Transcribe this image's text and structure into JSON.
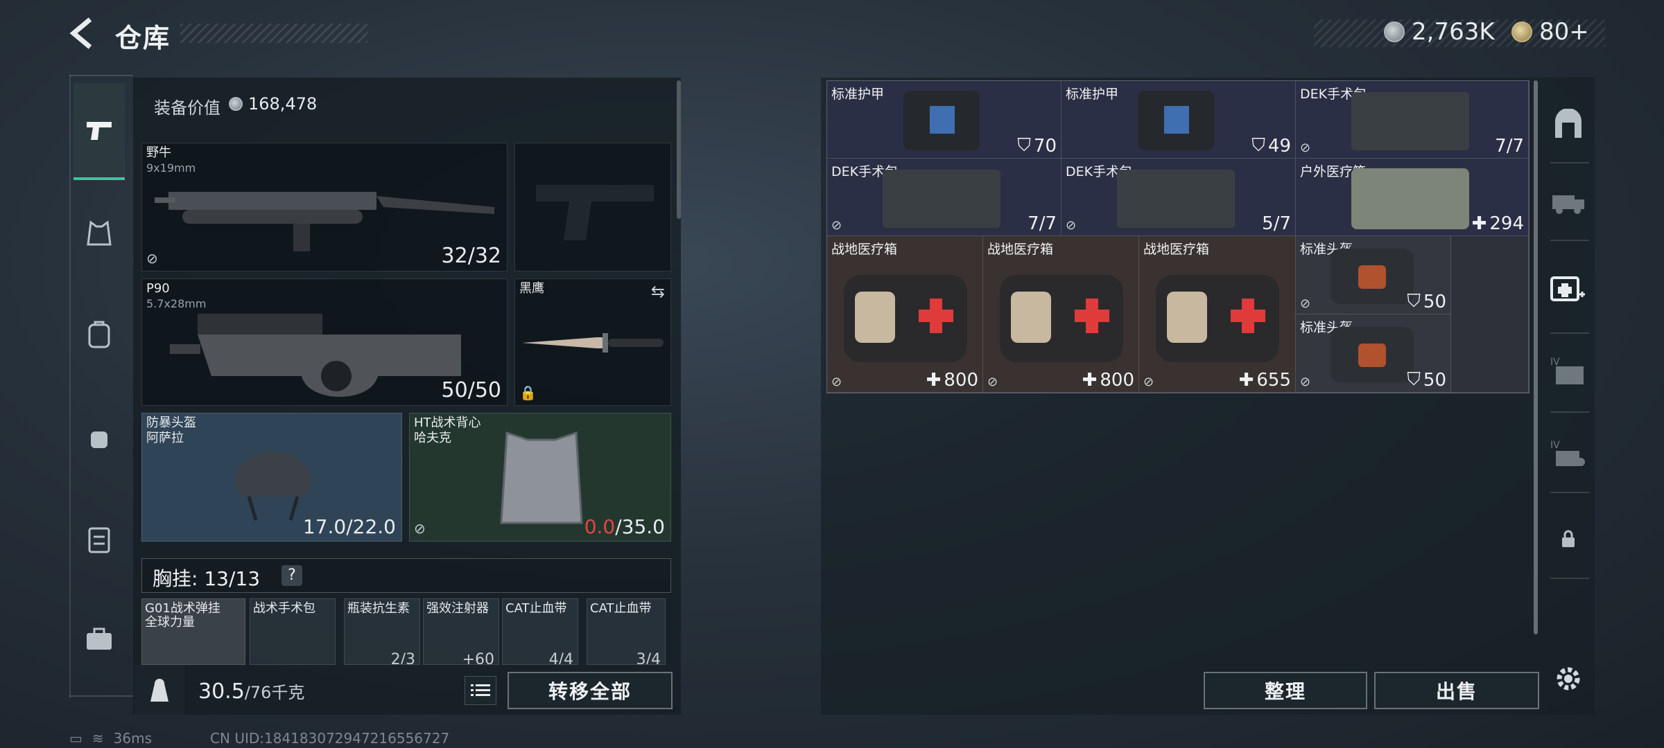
{
  "header": {
    "title": "仓库"
  },
  "currency": {
    "silver": "2,763K",
    "gold": "80+"
  },
  "equipment": {
    "value_label": "装备价值",
    "value": "168,478",
    "primary": {
      "name": "野牛",
      "caliber": "9x19mm",
      "count": "32/32"
    },
    "secondary": {
      "name": "P90",
      "caliber": "5.7x28mm",
      "count": "50/50"
    },
    "melee": {
      "name": "黑鹰"
    },
    "helmet": {
      "name": "防暴头盔",
      "brand": "阿萨拉",
      "durability": "17.0/22.0"
    },
    "vest": {
      "name": "HT战术背心",
      "brand": "哈夫克",
      "durability_current": "0.0",
      "durability_max": "/35.0"
    }
  },
  "chest_rig": {
    "label": "胸挂: 13/13",
    "help": "?",
    "items": [
      {
        "name": "G01战术弹挂\n全球力量"
      },
      {
        "name": "战术手术包"
      },
      {
        "name": "瓶装抗生素",
        "count": "2/3"
      },
      {
        "name": "强效注射器",
        "count": "+60"
      },
      {
        "name": "CAT止血带",
        "count": "4/4"
      },
      {
        "name": "CAT止血带",
        "count": "3/4"
      }
    ]
  },
  "footer": {
    "weight_current": "30.5",
    "weight_max": "/76千克",
    "transfer_all": "转移全部",
    "organize": "整理",
    "sell": "出售"
  },
  "storage": [
    {
      "name": "标准护甲",
      "count": "70",
      "count_icon": "shield-icon"
    },
    {
      "name": "标准护甲",
      "count": "49",
      "count_icon": "shield-icon"
    },
    {
      "name": "DEK手术包",
      "count": "7/7"
    },
    {
      "name": "DEK手术包",
      "count": "7/7"
    },
    {
      "name": "DEK手术包",
      "count": "5/7"
    },
    {
      "name": "户外医疗箱",
      "count": "294",
      "count_icon": "cross-icon"
    },
    {
      "name": "战地医疗箱",
      "count": "800",
      "count_icon": "cross-icon"
    },
    {
      "name": "战地医疗箱",
      "count": "800",
      "count_icon": "cross-icon"
    },
    {
      "name": "战地医疗箱",
      "count": "655",
      "count_icon": "cross-icon"
    },
    {
      "name": "标准头盔",
      "count": "50",
      "count_icon": "shield-icon"
    },
    {
      "name": "标准头盔",
      "count": "50",
      "count_icon": "shield-icon"
    }
  ],
  "status": {
    "ping": "36ms",
    "uid": "CN UID:1841830729472165567​27"
  },
  "colors": {
    "accent": "#39c7a0",
    "warning": "#e0483c"
  }
}
